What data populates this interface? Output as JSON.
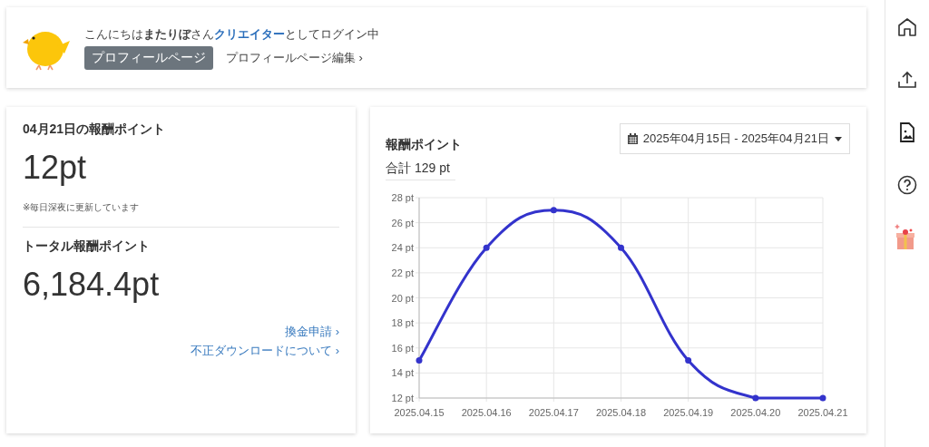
{
  "profile": {
    "greeting": "こんにちは**またりぼ**さん**クリエイター**としてログイン中",
    "profile_button": "プロフィールページ",
    "edit_link": "プロフィールページ編集 ›"
  },
  "daily": {
    "title": "04月21日の報酬ポイント",
    "value": "12pt",
    "note": "※毎日深夜に更新しています"
  },
  "total": {
    "title": "トータル報酬ポイント",
    "value": "6,184.4pt",
    "links": [
      "換金申請 ›",
      "不正ダウンロードについて ›"
    ]
  },
  "reward_chart": {
    "title": "報酬ポイント",
    "total": "合計 129 pt",
    "date_range": "2025年04月15日 - 2025年04月21日",
    "chart_data": {
      "type": "line",
      "categories": [
        "2025.04.15",
        "2025.04.16",
        "2025.04.17",
        "2025.04.18",
        "2025.04.19",
        "2025.04.20",
        "2025.04.21"
      ],
      "series": [
        {
          "color": "#3333cc",
          "marker": "circle",
          "values": [
            15,
            24,
            27,
            24,
            15,
            12,
            12
          ]
        }
      ],
      "grid": true,
      "ylim": [
        12,
        28
      ],
      "yticks": [
        {
          "value": 12,
          "label": "12 pt"
        },
        {
          "value": 14,
          "label": "14 pt"
        },
        {
          "value": 16,
          "label": "16 pt"
        },
        {
          "value": 18,
          "label": "18 pt"
        },
        {
          "value": 20,
          "label": "20 pt"
        },
        {
          "value": 22,
          "label": "22 pt"
        },
        {
          "value": 24,
          "label": "24 pt"
        },
        {
          "value": 26,
          "label": "26 pt"
        },
        {
          "value": 28,
          "label": "28 pt"
        }
      ]
    }
  },
  "sidebar": {
    "items": [
      {
        "kind": "home"
      },
      {
        "kind": "upload"
      },
      {
        "kind": "image-file"
      },
      {
        "kind": "help"
      },
      {
        "kind": "gift"
      }
    ]
  }
}
